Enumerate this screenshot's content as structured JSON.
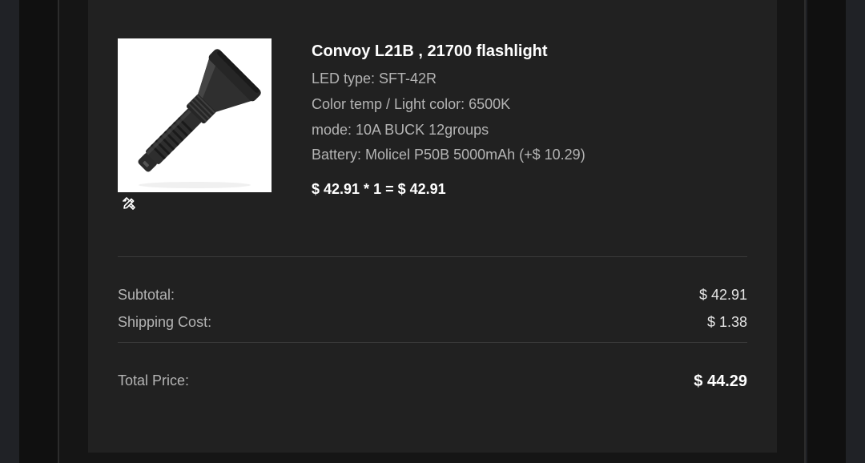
{
  "product": {
    "title": "Convoy L21B , 21700 flashlight",
    "image_icon": "flashlight-product-image",
    "options": [
      "LED type: SFT-42R",
      "Color temp / Light color: 6500K",
      "mode: 10A BUCK 12groups",
      "Battery: Molicel P50B 5000mAh (+$ 10.29)"
    ],
    "line_total": "$ 42.91 * 1 = $ 42.91",
    "edit_icon": "edit-pencil-ruler-icon"
  },
  "summary": {
    "subtotal_label": "Subtotal:",
    "subtotal_value": "$ 42.91",
    "shipping_label": "Shipping Cost:",
    "shipping_value": "$ 1.38",
    "total_label": "Total Price:",
    "total_value": "$ 44.29"
  },
  "colors": {
    "background": "#1d1f23",
    "card": "#212121",
    "text_primary": "#ffffff",
    "text_secondary": "#b4b4b4"
  }
}
